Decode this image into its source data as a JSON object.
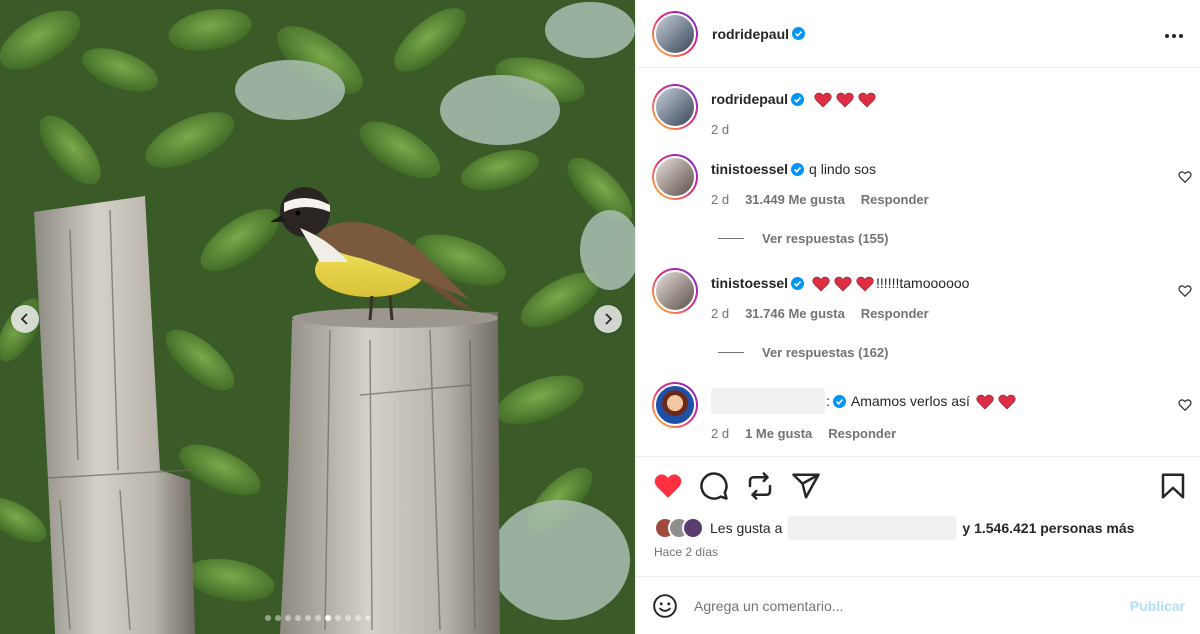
{
  "post": {
    "author": "rodridepaul",
    "caption_emojis": [
      "heart",
      "heart",
      "heart"
    ],
    "caption_time": "2 d",
    "carousel": {
      "total": 11,
      "active_index": 6
    }
  },
  "comments": [
    {
      "user": "tinistoessel",
      "text": "q lindo sos",
      "time": "2 d",
      "likes": "31.449 Me gusta",
      "reply": "Responder",
      "replies": "Ver respuestas (155)"
    },
    {
      "user": "tinistoessel",
      "text": "!!!!!!tamoooooo",
      "time": "2 d",
      "likes": "31.746 Me gusta",
      "reply": "Responder",
      "replies": "Ver respuestas (162)"
    },
    {
      "user": "",
      "text": "Amamos verlos así",
      "time": "2 d",
      "likes": "1 Me gusta",
      "reply": "Responder"
    }
  ],
  "likes": {
    "prefix": "Les gusta a",
    "suffix": "y 1.546.421 personas más",
    "time": "Hace 2 días"
  },
  "composer": {
    "placeholder": "Agrega un comentario...",
    "publish": "Publicar"
  },
  "colors": {
    "verified": "#0095f6",
    "like_red": "#ff3040",
    "publish_disabled": "#b2dffc"
  }
}
